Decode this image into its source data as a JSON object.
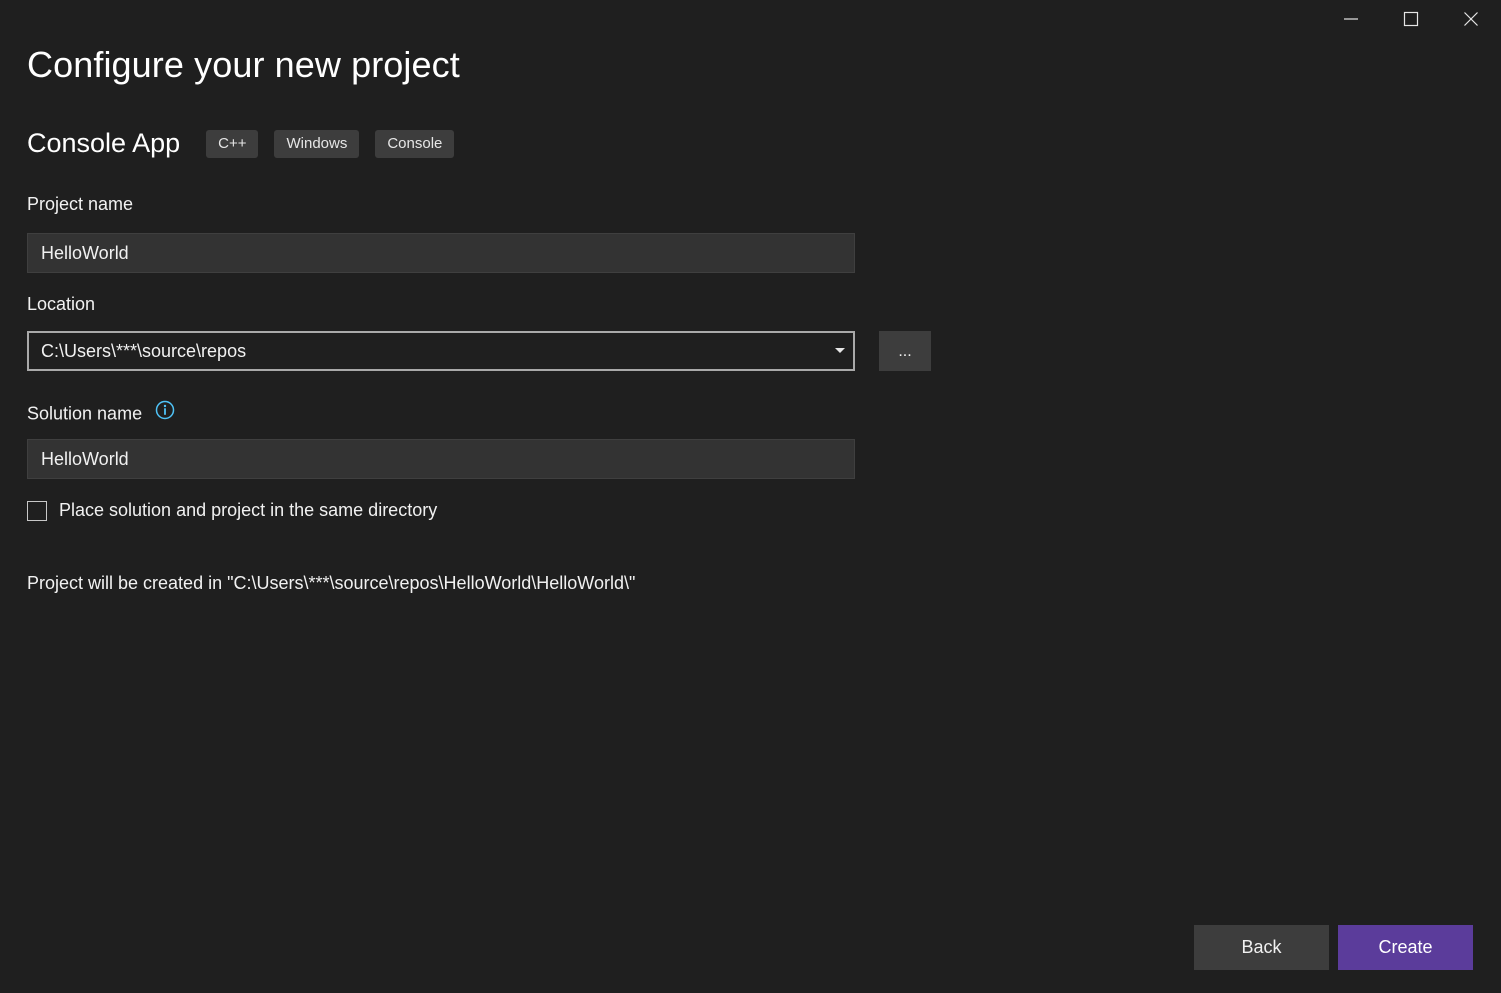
{
  "window": {
    "controls": {
      "minimize_icon": "minimize-icon",
      "maximize_icon": "maximize-icon",
      "close_icon": "close-icon"
    }
  },
  "header": {
    "title": "Configure your new project"
  },
  "template": {
    "name": "Console App",
    "tags": [
      "C++",
      "Windows",
      "Console"
    ]
  },
  "form": {
    "project_name": {
      "label": "Project name",
      "value": "HelloWorld"
    },
    "location": {
      "label": "Location",
      "value": "C:\\Users\\***\\source\\repos",
      "browse_label": "..."
    },
    "solution_name": {
      "label": "Solution name",
      "value": "HelloWorld",
      "info_icon": "info-icon"
    },
    "same_directory": {
      "label": "Place solution and project in the same directory",
      "checked": false
    }
  },
  "path_note": "Project will be created in \"C:\\Users\\***\\source\\repos\\HelloWorld\\HelloWorld\\\"",
  "footer": {
    "back_label": "Back",
    "create_label": "Create"
  },
  "colors": {
    "background": "#1f1f1f",
    "input_background": "#333333",
    "tag_background": "#3d3d3d",
    "accent": "#5b3c9b",
    "info_icon": "#4fc3f7"
  }
}
